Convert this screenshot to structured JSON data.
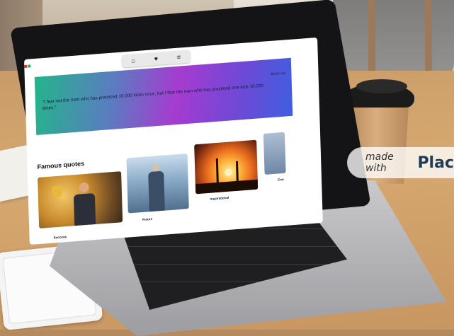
{
  "site": {
    "nav": {
      "icons": [
        "home-icon",
        "heart-icon",
        "menu-icon"
      ],
      "home_glyph": "⌂",
      "heart_glyph": "♥",
      "menu_glyph": "≡"
    },
    "hero": {
      "quote": "\"I fear not the man who has practiced 10,000 kicks once, but I fear the man who has practiced one kick 10,000 times.\"",
      "author": "~Bruce Lee"
    },
    "section_title": "Famous quotes",
    "cards": [
      {
        "label": "Success"
      },
      {
        "label": "Future"
      },
      {
        "label": "Inspirational"
      },
      {
        "label": "Cou"
      }
    ]
  },
  "watermark": {
    "made": "made with",
    "brand": "Plac"
  },
  "colors": {
    "hero_start": "#23b58a",
    "hero_mid": "#a63bd0",
    "hero_end": "#3f5fe0"
  }
}
